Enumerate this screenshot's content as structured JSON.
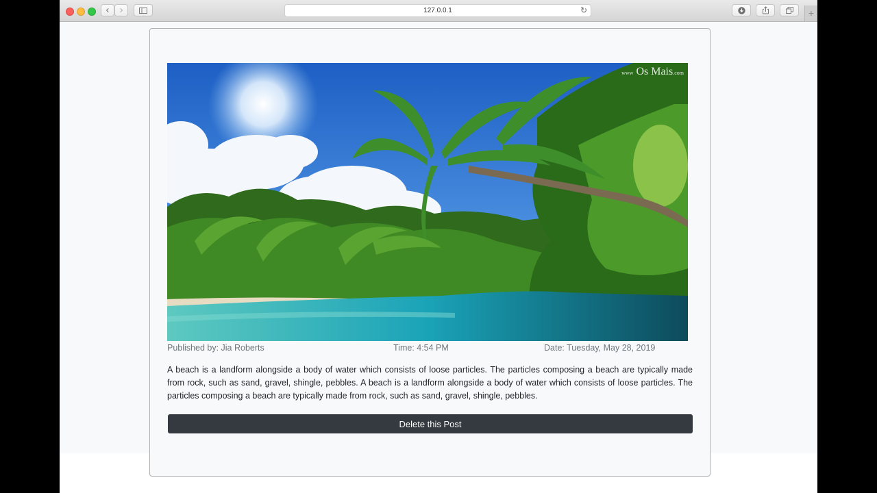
{
  "browser": {
    "url": "127.0.0.1",
    "reload_glyph": "↻",
    "back_glyph": "‹",
    "forward_glyph": "›",
    "new_tab_glyph": "+"
  },
  "post": {
    "image_watermark": "Os Mais",
    "watermark_prefix": "www",
    "watermark_suffix": ".com",
    "published_by": "Published by: Jia Roberts",
    "time": "Time: 4:54 PM",
    "date": "Date: Tuesday, May 28, 2019",
    "body": "A beach is a landform alongside a body of water which consists of loose particles. The particles composing a beach are typically made from rock, such as sand, gravel, shingle, pebbles. A beach is a landform alongside a body of water which consists of loose particles. The particles composing a beach are typically made from rock, such as sand, gravel, shingle, pebbles.",
    "delete_label": "Delete this Post"
  },
  "icons": {
    "close": "close-light-icon",
    "minimize": "minimize-light-icon",
    "zoom": "zoom-light-icon",
    "back": "chevron-left-icon",
    "forward": "chevron-right-icon",
    "sidebar": "sidebar-icon",
    "reload": "reload-icon",
    "download": "download-icon",
    "share": "share-icon",
    "tabs": "tabs-icon",
    "new_tab": "plus-icon"
  },
  "colors": {
    "button_bg": "#343a40",
    "meta_text": "#6c757d",
    "body_text": "#212529",
    "page_bg": "#f8f9fa"
  }
}
